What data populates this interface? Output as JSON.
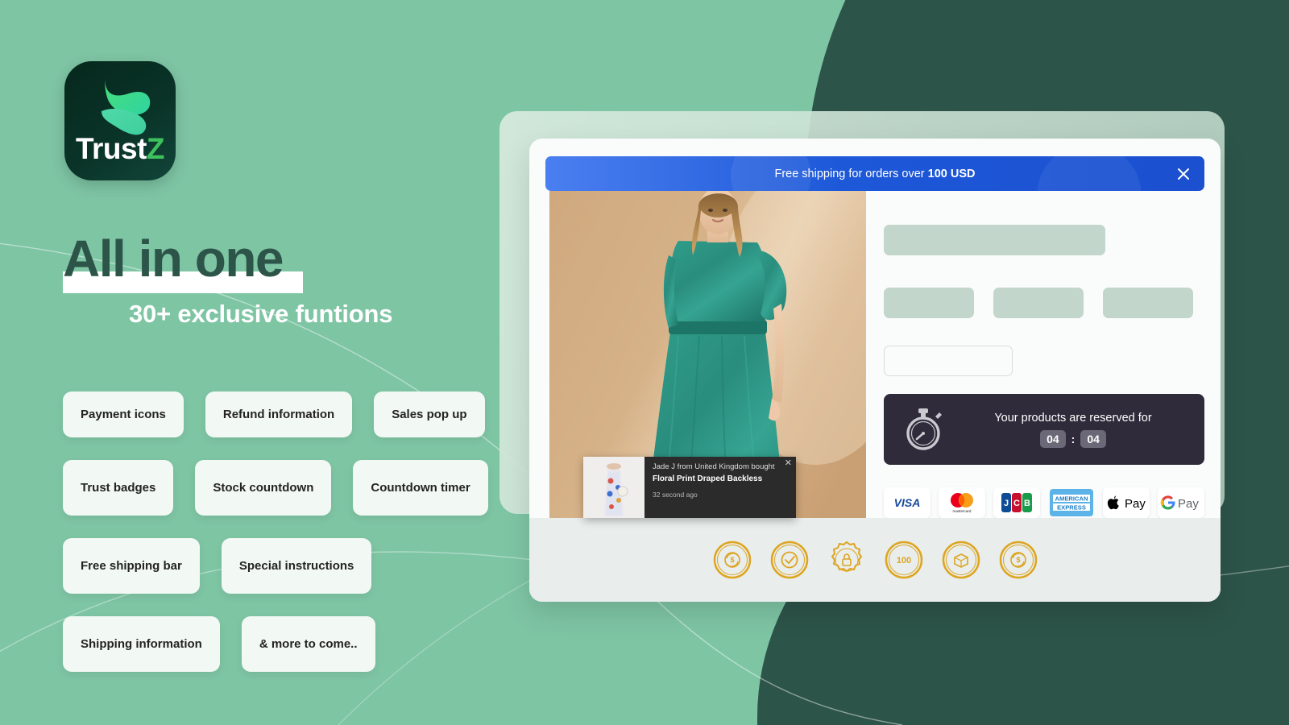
{
  "brand": {
    "logo_word_prefix": "Trust",
    "logo_word_accent": "Z",
    "logo_mark_name": "trustz-swirl-icon",
    "tile_color": "#0a3327",
    "accent_color": "#3ec15c"
  },
  "hero": {
    "headline": "All in one",
    "subheadline": "30+ exclusive funtions",
    "headline_color": "#2d5449",
    "background_color": "#7ec5a4",
    "dark_color": "#2d5449"
  },
  "features": {
    "rows": [
      [
        "Payment icons",
        "Refund information",
        "Sales pop up"
      ],
      [
        "Trust badges",
        "Stock countdown",
        "Countdown timer"
      ],
      [
        "Free shipping bar",
        "Special instructions"
      ],
      [
        "Shipping information",
        "& more to come.."
      ]
    ]
  },
  "mockup": {
    "shipping_bar": {
      "text_prefix": "Free shipping for orders over ",
      "amount": "100 USD",
      "close_icon": "close-x-icon",
      "gradient_from": "#4a7ff0",
      "gradient_to": "#1b50d0"
    },
    "product_image_alt": "Teal draped gown on model",
    "sales_popup": {
      "line1": "Jade J from United Kingdom bought",
      "product": "Floral Print Draped Backless",
      "time": "32 second ago",
      "close_icon": "close-x-icon"
    },
    "timer": {
      "icon": "stopwatch-icon",
      "label": "Your products are reserved for",
      "minutes": "04",
      "separator": ":",
      "seconds": "04",
      "panel_color": "#2f2b3a"
    },
    "payment_icons": [
      {
        "name": "visa-icon",
        "label": "VISA"
      },
      {
        "name": "mastercard-icon",
        "label": "mastercard"
      },
      {
        "name": "jcb-icon",
        "label": "JCB"
      },
      {
        "name": "amex-icon",
        "label": "AMERICAN EXPRESS"
      },
      {
        "name": "apple-pay-icon",
        "label": "Pay"
      },
      {
        "name": "google-pay-icon",
        "label": "Pay"
      }
    ],
    "trust_badges": [
      {
        "name": "money-back-guarantee-badge",
        "label": "MONEY BACK GUARANTEE"
      },
      {
        "name": "satisfaction-guarantee-badge",
        "label": "SATISFACTION GUARANTEE"
      },
      {
        "name": "secure-checkout-badge",
        "label": "SECURE CHECKOUT"
      },
      {
        "name": "premium-quality-badge",
        "label": "PREMIUM 100% QUALITY"
      },
      {
        "name": "free-returns-badge",
        "label": "FREE RETURNS"
      },
      {
        "name": "money-back-guarantee-badge-2",
        "label": "MONEY BACK GUARANTEE"
      }
    ],
    "badge_band_color": "#e9edeb",
    "skeleton_color": "#c3d6cb"
  }
}
